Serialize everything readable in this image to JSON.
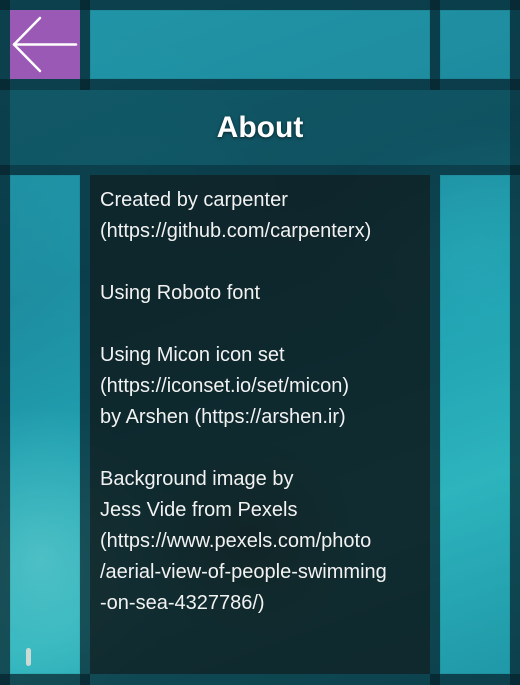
{
  "page": {
    "title": "About"
  },
  "header": {
    "back_icon": "arrow-left-icon"
  },
  "colors": {
    "accent": "#9b59b6",
    "text": "#ffffff",
    "panel": "#0c191c"
  },
  "about": {
    "paragraphs": [
      "Created by carpenter\n(https://github.com/carpenterx)",
      "Using Roboto font",
      "Using Micon icon set\n(https://iconset.io/set/micon)\nby Arshen (https://arshen.ir)",
      "Background image by\nJess Vide from Pexels\n(https://www.pexels.com/photo\n/aerial-view-of-people-swimming\n-on-sea-4327786/)"
    ]
  }
}
